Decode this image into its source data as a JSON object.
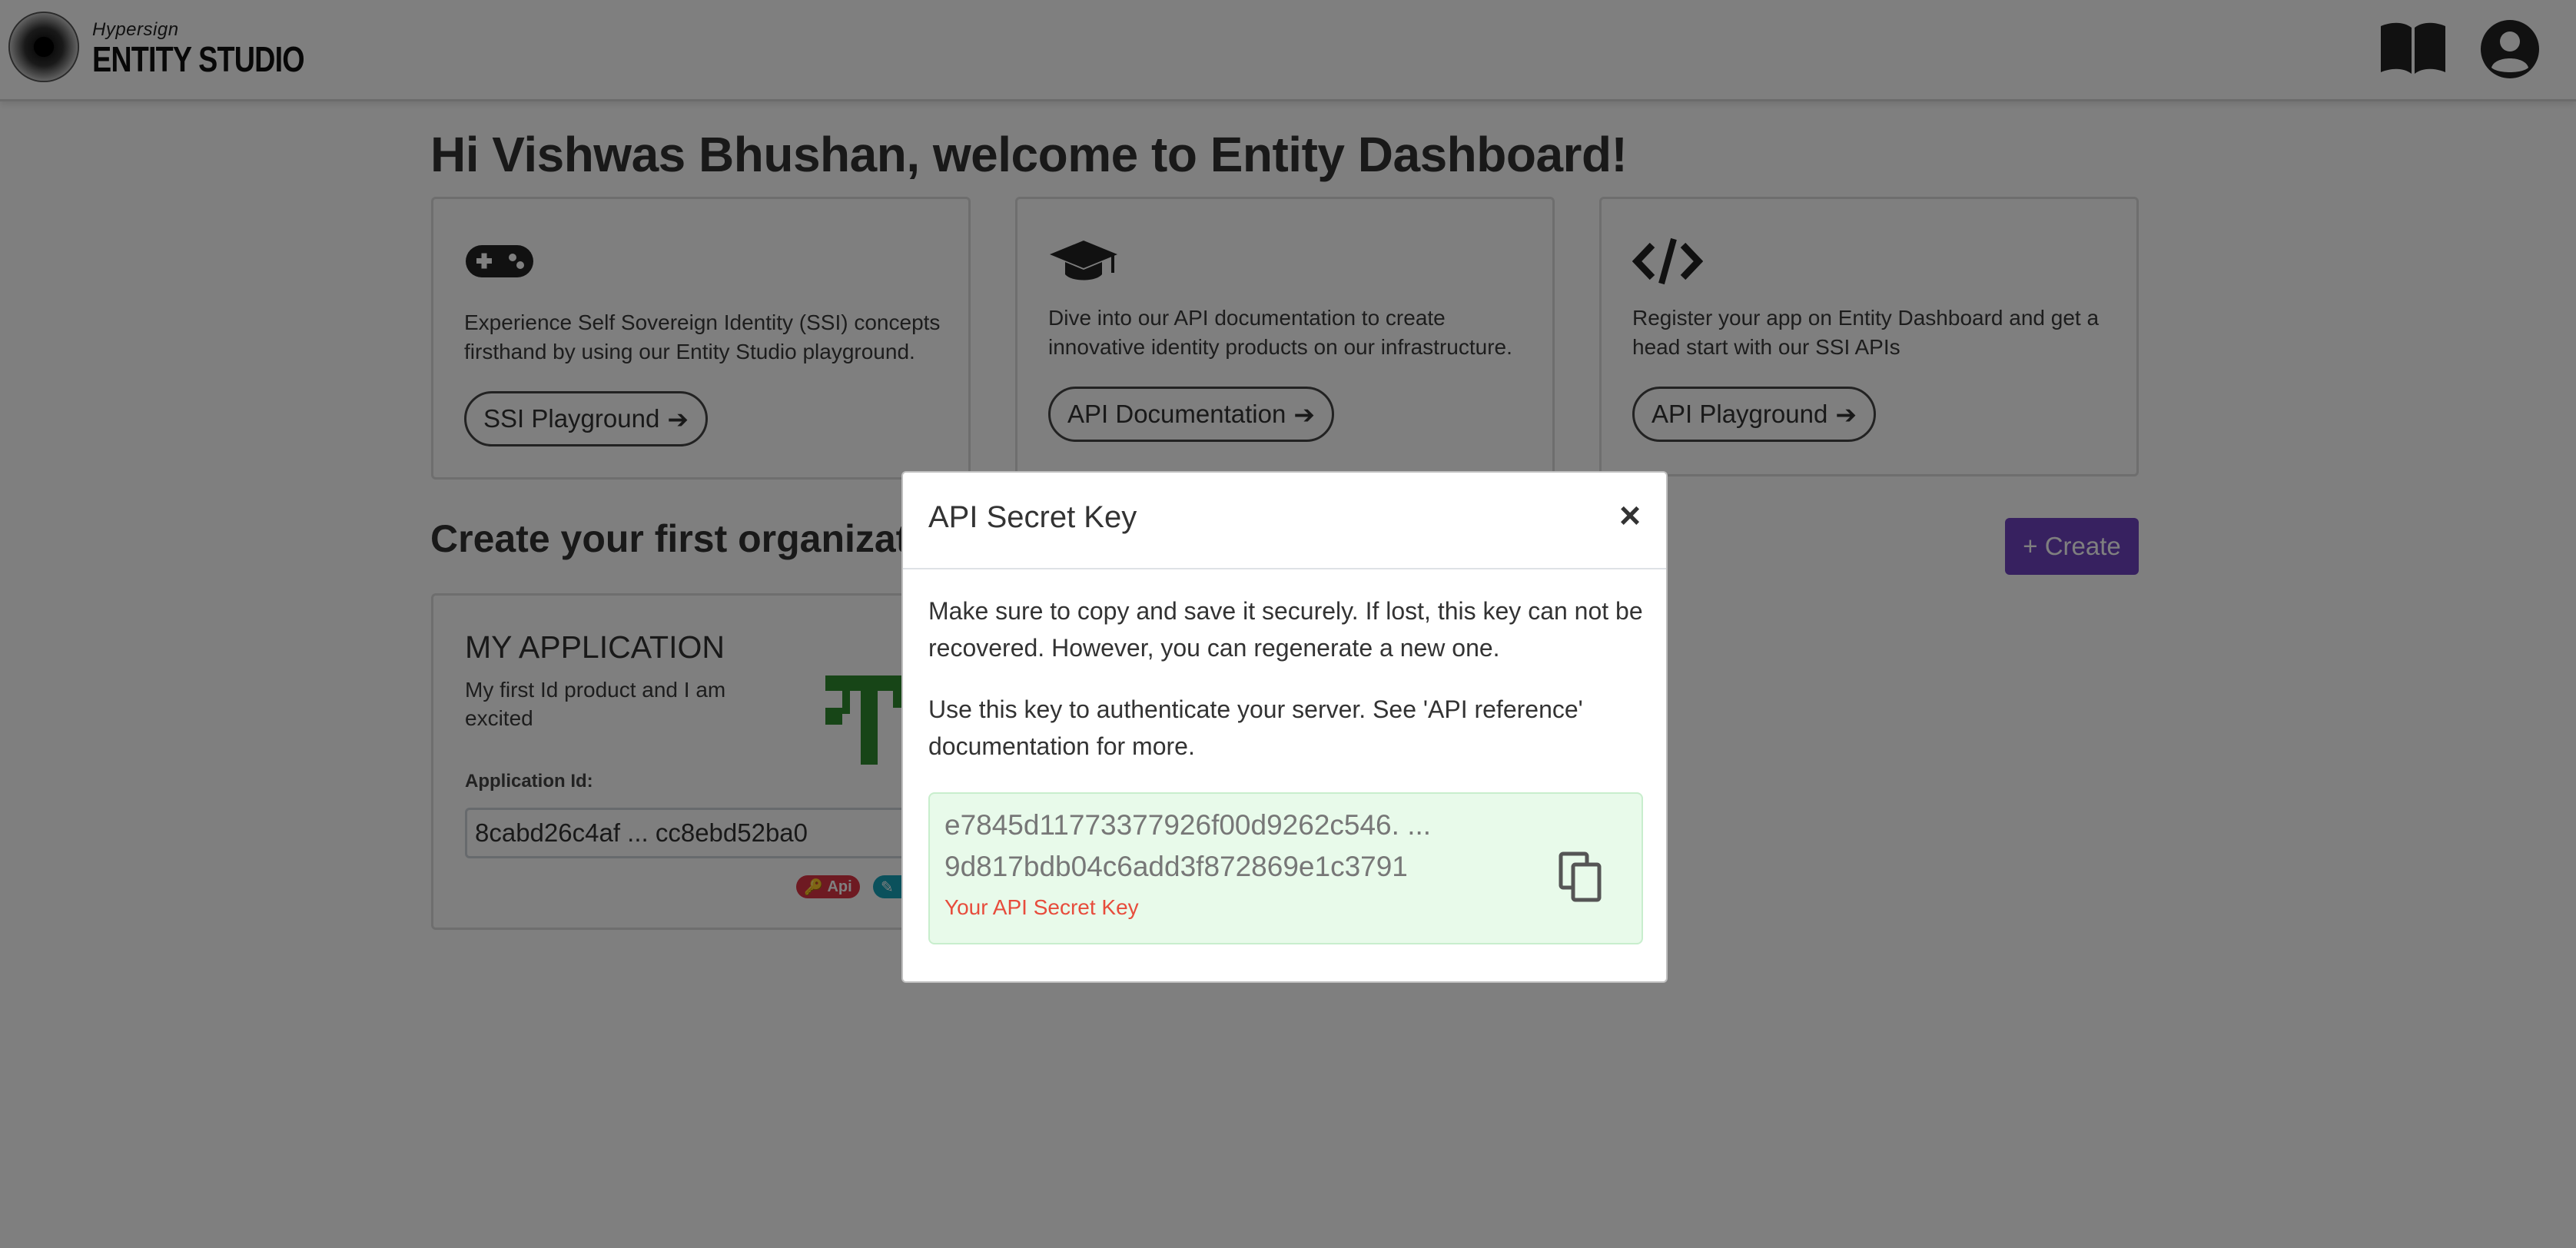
{
  "header": {
    "brand_small": "Hypersign",
    "brand_main": "ENTITY STUDIO",
    "icons": [
      "logo-icon",
      "book-icon",
      "user-icon"
    ]
  },
  "main": {
    "welcome": "Hi Vishwas Bhushan, welcome to Entity Dashboard!",
    "cards": [
      {
        "icon": "gamepad-icon",
        "text": "Experience Self Sovereign Identity (SSI) concepts firsthand by using our Entity Studio playground.",
        "button": "SSI Playground"
      },
      {
        "icon": "graduation-cap-icon",
        "text": "Dive into our API documentation to create innovative identity products on our infrastructure.",
        "button": "API Documentation"
      },
      {
        "icon": "code-icon",
        "text": "Register your app on Entity Dashboard and get a head start with our SSI APIs",
        "button": "API Playground"
      }
    ],
    "create_title": "Create your first organization",
    "create_button": "+ Create",
    "app": {
      "name": "MY APPLICATION",
      "description": "My first Id product and I am excited",
      "id_label": "Application Id:",
      "id_value": "8cabd26c4af ... cc8ebd52ba0",
      "badge_api": "Api"
    }
  },
  "modal": {
    "title": "API Secret Key",
    "close": "×",
    "paragraph1": "Make sure to copy and save it securely. If lost, this key can not be recovered. However, you can regenerate a new one.",
    "paragraph2": "Use this key to authenticate your server. See 'API reference' documentation for more.",
    "key_line1": "e7845d11773377926f00d9262c546. ...",
    "key_line2": "9d817bdb04c6add3f872869e1c3791",
    "key_caption": "Your API Secret Key"
  },
  "colors": {
    "accent": "#6f42c1",
    "key_box_bg": "#e8faea",
    "caption": "#e74c3c",
    "badge_api": "#dc3545",
    "badge_edit": "#17a2b8",
    "app_logo": "#2e8b2e"
  }
}
